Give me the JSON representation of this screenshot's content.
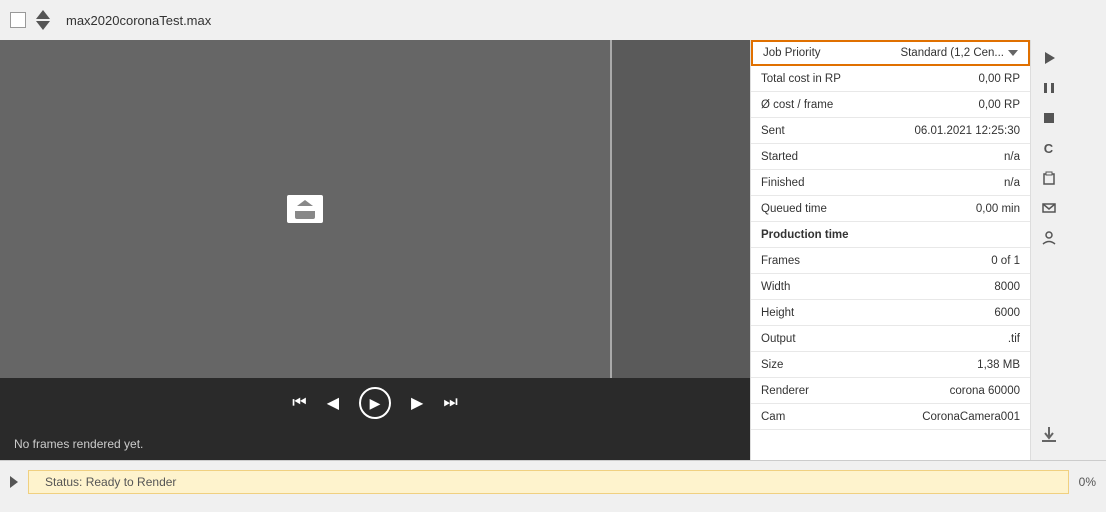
{
  "topbar": {
    "title": "max2020coronaTest.max"
  },
  "infoPanel": {
    "rows": [
      {
        "id": "job-priority",
        "label": "Job Priority",
        "value": "Standard (1,2 Cen...",
        "type": "dropdown",
        "highlighted": true
      },
      {
        "id": "total-cost",
        "label": "Total cost in RP",
        "value": "0,00 RP"
      },
      {
        "id": "avg-cost",
        "label": "Ø cost / frame",
        "value": "0,00 RP"
      },
      {
        "id": "sent",
        "label": "Sent",
        "value": "06.01.2021 12:25:30"
      },
      {
        "id": "started",
        "label": "Started",
        "value": "n/a"
      },
      {
        "id": "finished",
        "label": "Finished",
        "value": "n/a"
      },
      {
        "id": "queued-time",
        "label": "Queued time",
        "value": "0,00 min"
      },
      {
        "id": "production-time",
        "label": "Production time",
        "value": "",
        "type": "section"
      },
      {
        "id": "frames",
        "label": "Frames",
        "value": "0 of 1"
      },
      {
        "id": "width",
        "label": "Width",
        "value": "8000"
      },
      {
        "id": "height",
        "label": "Height",
        "value": "6000"
      },
      {
        "id": "output",
        "label": "Output",
        "value": ".tif"
      },
      {
        "id": "size",
        "label": "Size",
        "value": "1,38 MB"
      },
      {
        "id": "renderer",
        "label": "Renderer",
        "value": "corona 60000"
      },
      {
        "id": "cam",
        "label": "Cam",
        "value": "CoronaCamera001"
      }
    ]
  },
  "videoControls": {
    "skipBackLabel": "⏮",
    "prevLabel": "◀",
    "playLabel": "▶",
    "nextLabel": "▶",
    "skipFwdLabel": "⏭"
  },
  "statusBar": {
    "noFramesText": "No frames rendered yet.",
    "statusText": "Status: Ready to Render",
    "percent": "0%"
  },
  "sidebarIcons": [
    {
      "name": "play-icon",
      "symbol": "▶"
    },
    {
      "name": "pause-icon",
      "symbol": "⏸"
    },
    {
      "name": "stop-icon",
      "symbol": "■"
    },
    {
      "name": "c-icon",
      "symbol": "C"
    },
    {
      "name": "clipboard-icon",
      "symbol": "📋"
    },
    {
      "name": "mail-icon",
      "symbol": "✉"
    },
    {
      "name": "person-icon",
      "symbol": "👤"
    }
  ]
}
